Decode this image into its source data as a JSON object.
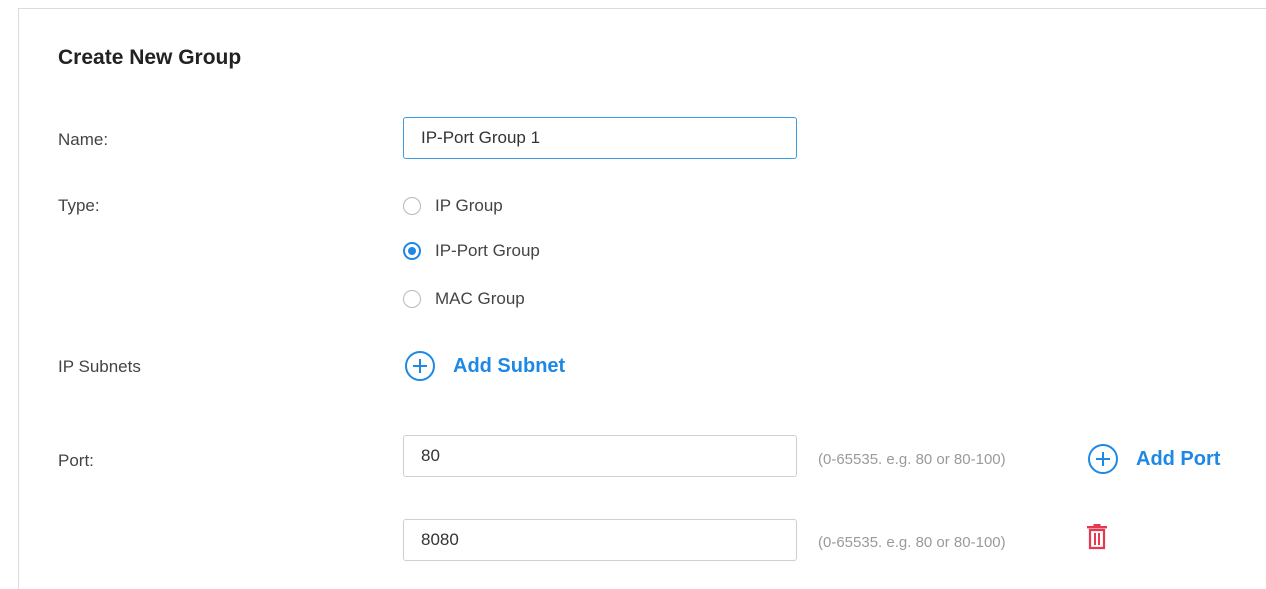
{
  "form": {
    "title": "Create New Group",
    "name_label": "Name:",
    "name_value": "IP-Port Group 1",
    "type_label": "Type:",
    "type_options": [
      {
        "label": "IP Group",
        "checked": false
      },
      {
        "label": "IP-Port Group",
        "checked": true
      },
      {
        "label": "MAC Group",
        "checked": false
      }
    ],
    "subnets_label": "IP Subnets",
    "add_subnet_label": "Add Subnet",
    "port_label": "Port:",
    "ports": [
      {
        "value": "80",
        "hint": "(0-65535. e.g. 80 or 80-100)"
      },
      {
        "value": "8080",
        "hint": "(0-65535. e.g. 80 or 80-100)"
      }
    ],
    "add_port_label": "Add Port"
  },
  "colors": {
    "accent": "#1e88e5",
    "delete": "#e53950",
    "hint": "#9a9a9a"
  },
  "icons": {
    "add_subnet": "plus-circle-icon",
    "add_port": "plus-circle-icon",
    "delete_port": "trash-icon"
  }
}
